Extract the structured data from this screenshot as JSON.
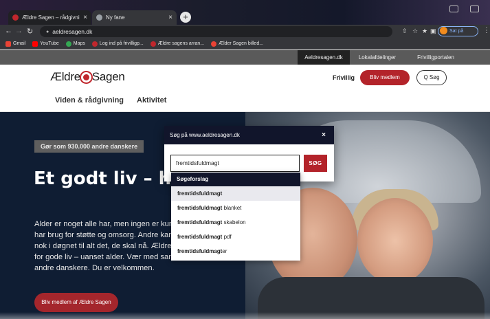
{
  "browser": {
    "tabs": [
      {
        "title": "Ældre Sagen – rådgivning, aktivi",
        "active": true
      },
      {
        "title": "Ny fane",
        "active": false
      }
    ],
    "new_tab_label": "+",
    "close_glyph": "×",
    "url": "aeldresagen.dk",
    "profile_status": "Sat på pause",
    "bookmarks": [
      {
        "label": "Gmail",
        "color": "#ea4335"
      },
      {
        "label": "YouTube",
        "color": "#ff0000"
      },
      {
        "label": "Maps",
        "color": "#34a853"
      },
      {
        "label": "Log ind på frivilligp...",
        "color": "#c0272d"
      },
      {
        "label": "Ældre sagens arran...",
        "color": "#c0272d"
      },
      {
        "label": "Ælder Sagen billed...",
        "color": "#ea4335"
      }
    ]
  },
  "site": {
    "utility_nav": [
      "Aeldresagen.dk",
      "Lokalafdelinger",
      "Frivilligportalen"
    ],
    "logo_left": "Ældre",
    "logo_right": "Sagen",
    "header_link": "Frivillig",
    "become_member": "Bliv medlem",
    "search_button": "Q Søg",
    "subnav": [
      "Viden & rådgivning",
      "Aktivitet"
    ],
    "hero": {
      "tag": "Gør som 930.000 andre danskere",
      "title": "Et godt liv – he livet.",
      "body": "Alder er noget alle har, men ingen er kun deres alder. Nogle har brug for støtte og omsorg. Andre kan ikke finde timer nok i døgnet til alt det, de skal nå. Ældre Sagen skaber rum for gode liv – uanset alder. Vær med sammen med 930.000 andre danskere. Du er velkommen.",
      "cta": "Bliv medlem af Ældre Sagen"
    }
  },
  "search_modal": {
    "title": "Søg på www.aeldresagen.dk",
    "close": "×",
    "input_value": "fremtidsfuldmagt",
    "submit": "SØG",
    "suggestions_header": "Søgeforslag",
    "suggestions": [
      {
        "bold": "fremtidsfuldmagt",
        "rest": ""
      },
      {
        "bold": "fremtidsfuldmagt",
        "rest": " blanket"
      },
      {
        "bold": "fremtidsfuldmagt",
        "rest": " skabelon"
      },
      {
        "bold": "fremtidsfuldmagt",
        "rest": " pdf"
      },
      {
        "bold": "fremtidsfuldmagt",
        "rest": "er"
      }
    ]
  }
}
